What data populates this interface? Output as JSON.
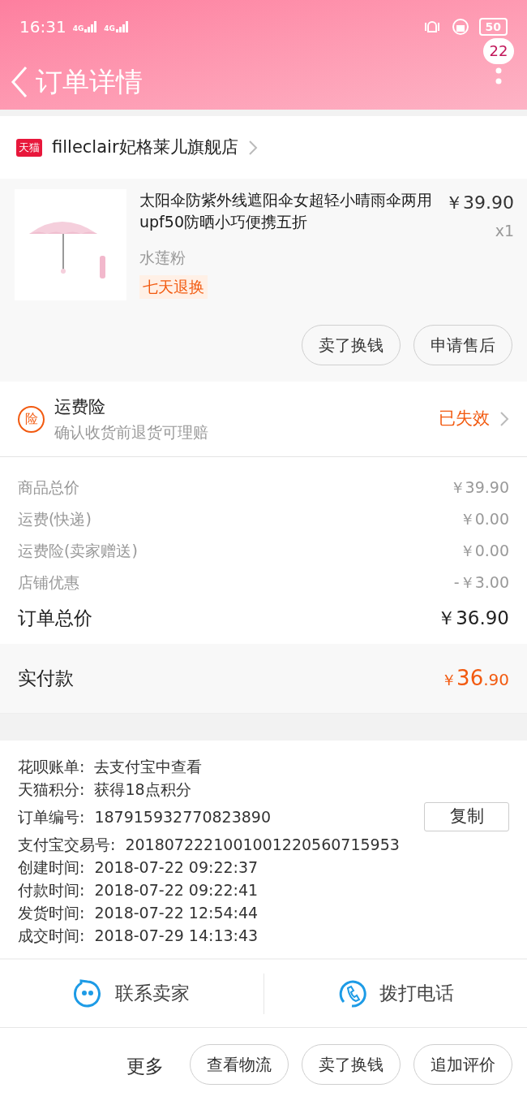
{
  "status_bar": {
    "time": "16:31",
    "network_1": "4G",
    "network_2": "4G",
    "battery": "50"
  },
  "header": {
    "title": "订单详情",
    "badge": "22"
  },
  "store": {
    "platform": "天猫",
    "name": "filleclair妃格莱儿旗舰店"
  },
  "product": {
    "title": "太阳伞防紫外线遮阳伞女超轻小晴雨伞两用upf50防晒小巧便携五折",
    "price": "￥39.90",
    "quantity": "x1",
    "variant": "水莲粉",
    "tag": "七天退换",
    "buttons": [
      "卖了换钱",
      "申请售后"
    ]
  },
  "insurance": {
    "icon": "险",
    "title": "运费险",
    "subtitle": "确认收货前退货可理赔",
    "status": "已失效"
  },
  "price_rows": [
    {
      "label": "商品总价",
      "value": "￥39.90"
    },
    {
      "label": "运费(快递)",
      "value": "￥0.00"
    },
    {
      "label": "运费险(卖家赠送)",
      "value": "￥0.00"
    },
    {
      "label": "店铺优惠",
      "value": "-￥3.00"
    }
  ],
  "order_total": {
    "label": "订单总价",
    "value": "￥36.90"
  },
  "paid": {
    "label": "实付款",
    "currency": "￥",
    "integer": "36",
    "decimal": ".90"
  },
  "info_rows": [
    {
      "label": "花呗账单:",
      "value": "去支付宝中查看"
    },
    {
      "label": "天猫积分:",
      "value": "获得18点积分"
    },
    {
      "label": "订单编号:",
      "value": "187915932770823890",
      "action": "复制"
    },
    {
      "label": "支付宝交易号:",
      "value": "2018072221001001220560715953"
    },
    {
      "label": "创建时间:",
      "value": "2018-07-22 09:22:37"
    },
    {
      "label": "付款时间:",
      "value": "2018-07-22 09:22:41"
    },
    {
      "label": "发货时间:",
      "value": "2018-07-22 12:54:44"
    },
    {
      "label": "成交时间:",
      "value": "2018-07-29 14:13:43"
    }
  ],
  "contact": [
    {
      "kind": "chat",
      "label": "联系卖家"
    },
    {
      "kind": "phone",
      "label": "拨打电话"
    }
  ],
  "more": {
    "label": "更多",
    "buttons": [
      "查看物流",
      "卖了换钱",
      "追加评价"
    ]
  }
}
